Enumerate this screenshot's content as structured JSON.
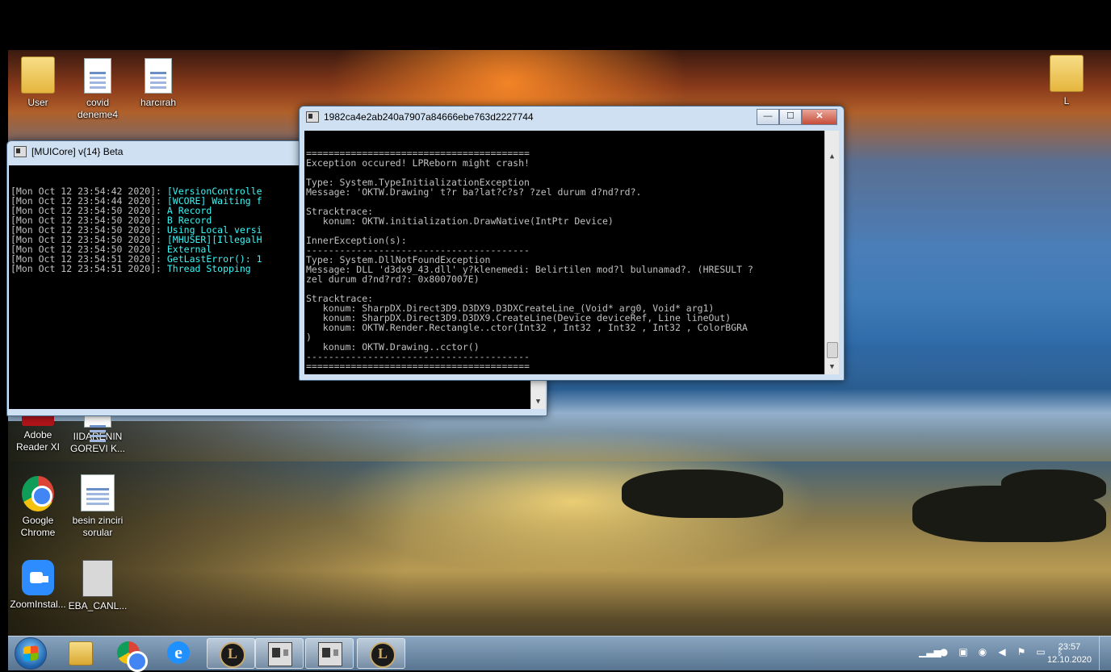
{
  "desktop_icons": {
    "user": "User",
    "covid": "covid\ndeneme4",
    "harcirah": "harcırah",
    "l_folder": "L",
    "adobe": "Adobe\nReader XI",
    "idarenin": "IIDARENIN\nGOREVI K...",
    "chrome": "Google\nChrome",
    "besin": "besin zinciri\nsorular",
    "zoom": "ZoomInstal...",
    "eba": "EBA_CANL..."
  },
  "muicore_window": {
    "title": "[MUICore] v{14} Beta",
    "lines": [
      {
        "ts": "[Mon Oct 12 23:54:42 2020]: ",
        "msg": "[VersionControlle"
      },
      {
        "ts": "[Mon Oct 12 23:54:44 2020]: ",
        "msg": "[WCORE] Waiting f"
      },
      {
        "ts": "[Mon Oct 12 23:54:50 2020]: ",
        "msg": "A Record"
      },
      {
        "ts": "[Mon Oct 12 23:54:50 2020]: ",
        "msg": "B Record"
      },
      {
        "ts": "[Mon Oct 12 23:54:50 2020]: ",
        "msg": "Using Local versi"
      },
      {
        "ts": "[Mon Oct 12 23:54:50 2020]: ",
        "msg": "[MHUSER][IllegalH"
      },
      {
        "ts": "[Mon Oct 12 23:54:50 2020]: ",
        "msg": "External"
      },
      {
        "ts": "[Mon Oct 12 23:54:51 2020]: ",
        "msg": "GetLastError(): 1"
      },
      {
        "ts": "[Mon Oct 12 23:54:51 2020]: ",
        "msg": "Thread Stopping"
      }
    ]
  },
  "error_window": {
    "title": "1982ca4e2ab240a7907a84666ebe763d2227744",
    "lines": [
      "========================================",
      "Exception occured! LPReborn might crash!",
      "",
      "Type: System.TypeInitializationException",
      "Message: 'OKTW.Drawing' t?r ba?lat?c?s? ?zel durum d?nd?rd?.",
      "",
      "Stracktrace:",
      "   konum: OKTW.initialization.DrawNative(IntPtr Device)",
      "",
      "InnerException(s):",
      "----------------------------------------",
      "Type: System.DllNotFoundException",
      "Message: DLL 'd3dx9_43.dll' y?klenemedi: Belirtilen mod?l bulunamad?. (HRESULT ?",
      "zel durum d?nd?rd?: 0x8007007E)",
      "",
      "Stracktrace:",
      "   konum: SharpDX.Direct3D9.D3DX9.D3DXCreateLine_(Void* arg0, Void* arg1)",
      "   konum: SharpDX.Direct3D9.D3DX9.CreateLine(Device deviceRef, Line lineOut)",
      "   konum: OKTW.Render.Rectangle..ctor(Int32 , Int32 , Int32 , Int32 , ColorBGRA",
      ")",
      "   konum: OKTW.Drawing..cctor()",
      "----------------------------------------",
      "========================================"
    ],
    "buttons": {
      "minimize": "—",
      "maximize": "☐",
      "close": "✕"
    }
  },
  "taskbar": {
    "time": "23:57",
    "date": "12.10.2020",
    "ie_glyph": "e",
    "lol_glyph": "L"
  },
  "scroll": {
    "up": "▲",
    "down": "▼"
  }
}
